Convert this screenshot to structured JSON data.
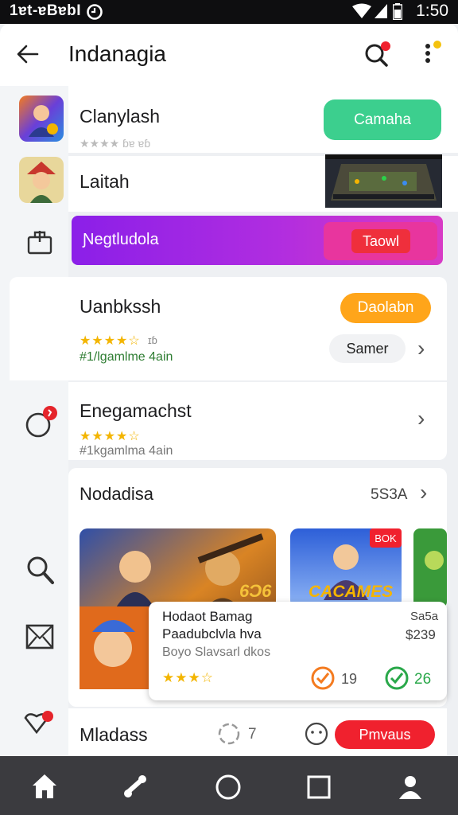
{
  "status_bar": {
    "left_text": "1ɐt-ɐBɐbI",
    "time": "1:50"
  },
  "header": {
    "title": "Indanagia"
  },
  "rows": {
    "row1": {
      "name": "Clanylash",
      "stars_text": "★★★★ ɓɐ ɐɓ",
      "button": "Camaha"
    },
    "row2": {
      "name": "Laitah"
    },
    "banner": {
      "text": "Ɲegtludola",
      "button": "Taowl"
    },
    "row3": {
      "name": "Uanbkssh",
      "rating_tag": "ɪɓ",
      "sub": "#1/lgamlme 4ain",
      "button": "Daolabn",
      "secondary": "Samer"
    },
    "row4": {
      "name": "Enegamachst",
      "sub": "#1kgamlma 4ain"
    }
  },
  "section": {
    "title": "Nodadisa",
    "link": "5S3A",
    "tile2_text": "CACAMES",
    "tile2_badge": "BOK",
    "tile1_badge": "6Ɔ6"
  },
  "popup": {
    "line1": "Hodaot Bamag",
    "line2": "Paadubclvla hva",
    "line3": "Boyo Slavsarl dkos",
    "price1": "Sa5a",
    "price2": "$239",
    "count1": "19",
    "count2": "26"
  },
  "footer_row": {
    "name": "Mladass",
    "count": "7",
    "button": "Pmvaus"
  },
  "colors": {
    "green": "#3ccf8e",
    "purple": "#8b1fe8",
    "orange": "#ffa51a",
    "red": "#f0212e"
  },
  "icons": [
    "back-icon",
    "search-icon",
    "more-icon",
    "home-icon",
    "share-icon",
    "circle-icon",
    "square-icon",
    "profile-icon"
  ]
}
